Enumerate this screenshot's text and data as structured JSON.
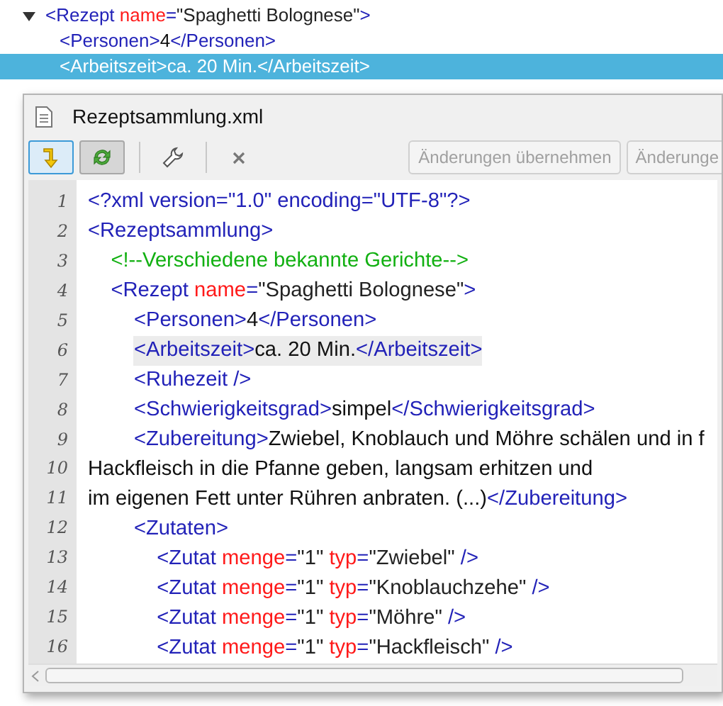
{
  "tree": {
    "tokens": [
      {
        "kind": "tag",
        "text": "<Rezept "
      },
      {
        "kind": "attr",
        "text": "name"
      },
      {
        "kind": "tag",
        "text": "="
      },
      {
        "kind": "value",
        "text": "\"Spaghetti Bolognese\""
      },
      {
        "kind": "tag",
        "text": ">"
      }
    ],
    "expanded": true,
    "selected": false,
    "children": [
      {
        "tokens": [
          {
            "kind": "tag",
            "text": "<Personen>"
          },
          {
            "kind": "text",
            "text": "4"
          },
          {
            "kind": "tag",
            "text": "</Personen>"
          }
        ],
        "selected": false
      },
      {
        "tokens": [
          {
            "kind": "tag",
            "text": "<Arbeitszeit>"
          },
          {
            "kind": "text",
            "text": "ca. 20 Min."
          },
          {
            "kind": "tag",
            "text": "</Arbeitszeit>"
          }
        ],
        "selected": true
      }
    ]
  },
  "window": {
    "title": "Rezeptsammlung.xml"
  },
  "toolbar": {
    "toggles": [
      {
        "selected": true
      },
      {
        "selected": false
      }
    ],
    "buttons": [
      {
        "label": "Änderungen übernehmen",
        "disabled": true
      },
      {
        "label": "Änderunge",
        "disabled": true
      }
    ]
  },
  "editor": {
    "lines": [
      {
        "number": "1",
        "highlighted": false,
        "tokens": [
          {
            "kind": "tag",
            "text": "<?xml version=\"1.0\" encoding=\"UTF-8\"?>"
          }
        ]
      },
      {
        "number": "2",
        "highlighted": false,
        "tokens": [
          {
            "kind": "tag",
            "text": "<Rezeptsammlung>"
          }
        ]
      },
      {
        "number": "3",
        "highlighted": false,
        "tokens": [
          {
            "kind": "comment",
            "text": "    <!--Verschiedene bekannte Gerichte-->"
          }
        ]
      },
      {
        "number": "4",
        "highlighted": false,
        "tokens": [
          {
            "kind": "tag",
            "text": "    <Rezept "
          },
          {
            "kind": "attr",
            "text": "name"
          },
          {
            "kind": "tag",
            "text": "="
          },
          {
            "kind": "value",
            "text": "\"Spaghetti Bolognese\""
          },
          {
            "kind": "tag",
            "text": ">"
          }
        ]
      },
      {
        "number": "5",
        "highlighted": false,
        "tokens": [
          {
            "kind": "tag",
            "text": "        <Personen>"
          },
          {
            "kind": "text",
            "text": "4"
          },
          {
            "kind": "tag",
            "text": "</Personen>"
          }
        ]
      },
      {
        "number": "6",
        "highlighted": true,
        "tokens": [
          {
            "kind": "tag",
            "text": "        <Arbeitszeit>"
          },
          {
            "kind": "text",
            "text": "ca. 20 Min."
          },
          {
            "kind": "tag",
            "text": "</Arbeitszeit>"
          }
        ]
      },
      {
        "number": "7",
        "highlighted": false,
        "tokens": [
          {
            "kind": "tag",
            "text": "        <Ruhezeit />"
          }
        ]
      },
      {
        "number": "8",
        "highlighted": false,
        "tokens": [
          {
            "kind": "tag",
            "text": "        <Schwierigkeitsgrad>"
          },
          {
            "kind": "text",
            "text": "simpel"
          },
          {
            "kind": "tag",
            "text": "</Schwierigkeitsgrad>"
          }
        ]
      },
      {
        "number": "9",
        "highlighted": false,
        "tokens": [
          {
            "kind": "tag",
            "text": "        <Zubereitung>"
          },
          {
            "kind": "text",
            "text": "Zwiebel, Knoblauch und Möhre schälen und in f"
          }
        ]
      },
      {
        "number": "10",
        "highlighted": false,
        "tokens": [
          {
            "kind": "text",
            "text": "Hackfleisch in die Pfanne geben, langsam erhitzen und"
          }
        ]
      },
      {
        "number": "11",
        "highlighted": false,
        "tokens": [
          {
            "kind": "text",
            "text": "im eigenen Fett unter Rühren anbraten. (...)"
          },
          {
            "kind": "tag",
            "text": "</Zubereitung>"
          }
        ]
      },
      {
        "number": "12",
        "highlighted": false,
        "tokens": [
          {
            "kind": "tag",
            "text": "        <Zutaten>"
          }
        ]
      },
      {
        "number": "13",
        "highlighted": false,
        "tokens": [
          {
            "kind": "tag",
            "text": "            <Zutat "
          },
          {
            "kind": "attr",
            "text": "menge"
          },
          {
            "kind": "tag",
            "text": "="
          },
          {
            "kind": "value",
            "text": "\"1\" "
          },
          {
            "kind": "attr",
            "text": "typ"
          },
          {
            "kind": "tag",
            "text": "="
          },
          {
            "kind": "value",
            "text": "\"Zwiebel\" "
          },
          {
            "kind": "tag",
            "text": "/>"
          }
        ]
      },
      {
        "number": "14",
        "highlighted": false,
        "tokens": [
          {
            "kind": "tag",
            "text": "            <Zutat "
          },
          {
            "kind": "attr",
            "text": "menge"
          },
          {
            "kind": "tag",
            "text": "="
          },
          {
            "kind": "value",
            "text": "\"1\" "
          },
          {
            "kind": "attr",
            "text": "typ"
          },
          {
            "kind": "tag",
            "text": "="
          },
          {
            "kind": "value",
            "text": "\"Knoblauchzehe\" "
          },
          {
            "kind": "tag",
            "text": "/>"
          }
        ]
      },
      {
        "number": "15",
        "highlighted": false,
        "tokens": [
          {
            "kind": "tag",
            "text": "            <Zutat "
          },
          {
            "kind": "attr",
            "text": "menge"
          },
          {
            "kind": "tag",
            "text": "="
          },
          {
            "kind": "value",
            "text": "\"1\" "
          },
          {
            "kind": "attr",
            "text": "typ"
          },
          {
            "kind": "tag",
            "text": "="
          },
          {
            "kind": "value",
            "text": "\"Möhre\" "
          },
          {
            "kind": "tag",
            "text": "/>"
          }
        ]
      },
      {
        "number": "16",
        "highlighted": false,
        "tokens": [
          {
            "kind": "tag",
            "text": "            <Zutat "
          },
          {
            "kind": "attr",
            "text": "menge"
          },
          {
            "kind": "tag",
            "text": "="
          },
          {
            "kind": "value",
            "text": "\"1\" "
          },
          {
            "kind": "attr",
            "text": "typ"
          },
          {
            "kind": "tag",
            "text": "="
          },
          {
            "kind": "value",
            "text": "\"Hackfleisch\" "
          },
          {
            "kind": "tag",
            "text": "/>"
          }
        ]
      }
    ]
  }
}
